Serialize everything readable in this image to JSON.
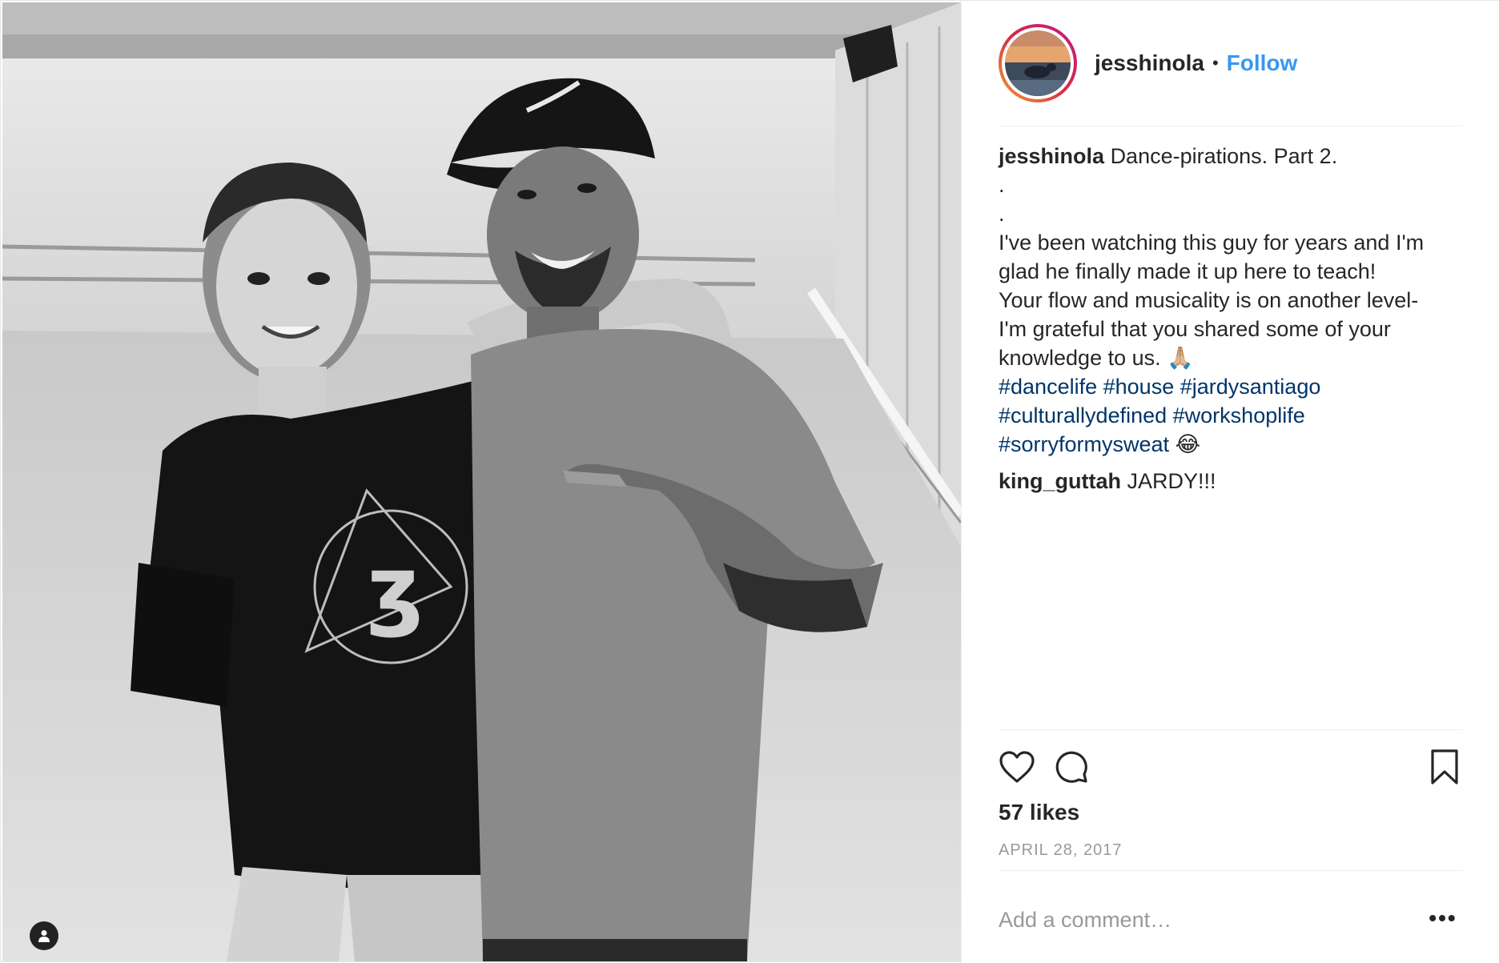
{
  "post": {
    "username": "jesshinola",
    "separator": "•",
    "follow_label": "Follow",
    "caption": {
      "username": "jesshinola",
      "first_line": "Dance-pirations. Part 2.",
      "dot1": ".",
      "dot2": ".",
      "lines": [
        "I've been watching this guy for years and I'm",
        "glad he finally made it up here to teach!",
        "Your flow and musicality is on another level-",
        "I'm grateful that you shared some of your"
      ],
      "last_line": "knowledge to us.",
      "last_line_emoji": "🙏🏼",
      "hashtags_line1": [
        "#dancelife",
        "#house",
        "#jardysantiago"
      ],
      "hashtags_line2": [
        "#culturallydefined",
        "#workshoplife"
      ],
      "hashtags_line3": [
        "#sorryformysweat"
      ],
      "hashtags_line3_emoji": "😂"
    },
    "comment": {
      "username": "king_guttah",
      "text": "JARDY!!!"
    },
    "likes": "57 likes",
    "date": "APRIL 28, 2017",
    "comment_placeholder": "Add a comment…",
    "more_label": "•••"
  },
  "icons": {
    "like": "heart-icon",
    "comment": "comment-icon",
    "save": "bookmark-icon",
    "tagged": "user-tag-icon"
  },
  "colors": {
    "link": "#3897f0",
    "hashtag": "#003569",
    "muted": "#999999",
    "text": "#262626"
  }
}
